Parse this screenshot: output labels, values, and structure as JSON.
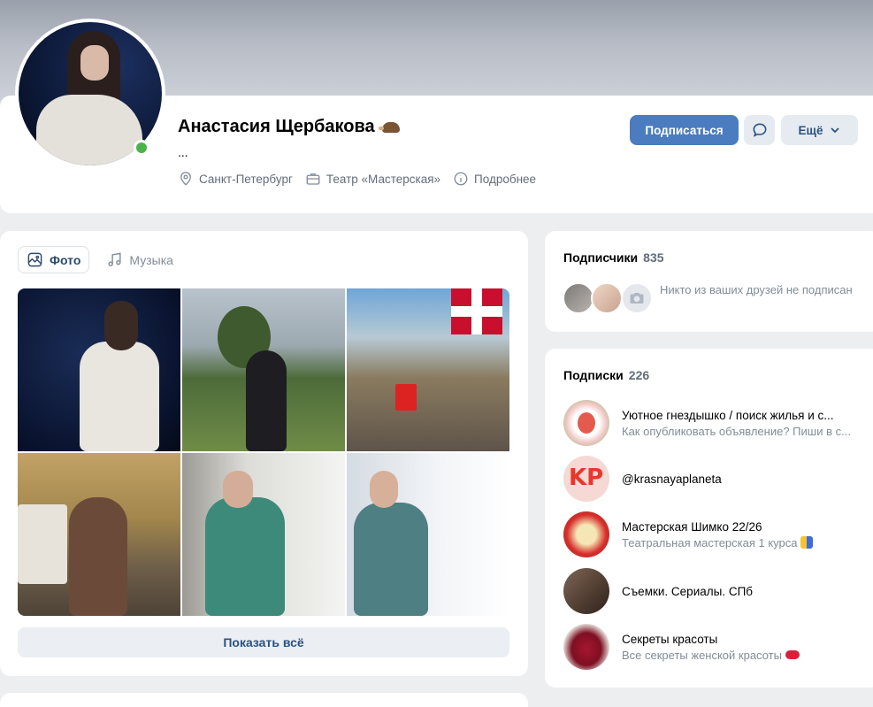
{
  "profile": {
    "name": "Анастасия Щербакова",
    "status": "...",
    "city": "Санкт-Петербург",
    "work": "Театр «Мастерская»",
    "more_info": "Подробнее",
    "online": true
  },
  "actions": {
    "subscribe": "Подписаться",
    "more": "Ещё"
  },
  "tabs": [
    {
      "label": "Фото",
      "active": true
    },
    {
      "label": "Музыка",
      "active": false
    }
  ],
  "photos": {
    "show_all": "Показать всё"
  },
  "followers": {
    "title": "Подписчики",
    "count": "835",
    "note": "Никто из ваших друзей не подписан"
  },
  "subscriptions": {
    "title": "Подписки",
    "count": "226",
    "items": [
      {
        "name": "Уютное гнездышко / поиск жилья и с...",
        "desc": "Как опубликовать объявление? Пиши в с..."
      },
      {
        "name": "@krasnayaplaneta",
        "desc": ""
      },
      {
        "name": "Мастерская Шимко 22/26",
        "desc": "Театральная мастерская 1 курса"
      },
      {
        "name": "Съемки. Сериалы. СПб",
        "desc": ""
      },
      {
        "name": "Секреты красоты",
        "desc": "Все секреты женской красоты"
      }
    ]
  },
  "colors": {
    "primary": "#4a7cbf",
    "online": "#4bb34b",
    "link": "#2c5282",
    "muted": "#818c99"
  }
}
